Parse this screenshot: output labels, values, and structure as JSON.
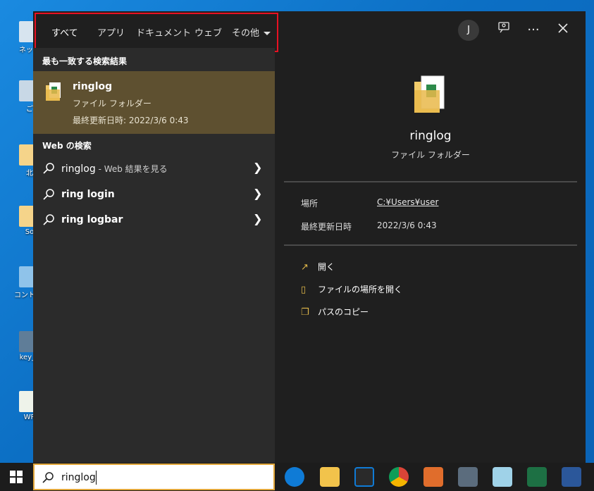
{
  "desktop": {
    "icons": [
      {
        "label": "ネット",
        "icon": "network-icon"
      },
      {
        "label": "ご",
        "icon": "recycle-bin-icon"
      },
      {
        "label": "北",
        "icon": "folder-icon"
      },
      {
        "label": "So",
        "icon": "folder-icon"
      },
      {
        "label": "コントロー",
        "icon": "control-panel-icon"
      },
      {
        "label": "key_p",
        "icon": "keyboard-icon"
      },
      {
        "label": "WR",
        "icon": "document-icon"
      }
    ]
  },
  "tabs": [
    {
      "label": "すべて",
      "active": true
    },
    {
      "label": "アプリ"
    },
    {
      "label": "ドキュメント"
    },
    {
      "label": "ウェブ"
    },
    {
      "label": "その他"
    }
  ],
  "header": {
    "avatar_initial": "J"
  },
  "best_match": {
    "heading": "最も一致する検索結果",
    "name": "ringlog",
    "type": "ファイル フォルダー",
    "modified": "最終更新日時: 2022/3/6 0:43"
  },
  "web": {
    "heading": "Web の検索",
    "results": [
      {
        "query": "ringlog",
        "suffix": " - Web 結果を見る"
      },
      {
        "query": "ring login",
        "suffix": ""
      },
      {
        "query": "ring logbar",
        "suffix": ""
      }
    ]
  },
  "detail": {
    "name": "ringlog",
    "type": "ファイル フォルダー",
    "location_label": "場所",
    "location_value": "C:¥Users¥user",
    "modified_label": "最終更新日時",
    "modified_value": "2022/3/6 0:43",
    "actions": [
      {
        "label": "開く",
        "icon": "open-icon"
      },
      {
        "label": "ファイルの場所を開く",
        "icon": "folder-location-icon"
      },
      {
        "label": "パスのコピー",
        "icon": "copy-icon"
      }
    ]
  },
  "taskbar": {
    "search_value": "ringlog",
    "apps": [
      "edge-icon",
      "file-explorer-icon",
      "store-icon",
      "chrome-icon",
      "media-player-icon",
      "calculator-icon",
      "notepad-icon",
      "excel-icon",
      "word-icon"
    ]
  },
  "colors": {
    "accent": "#e2a73a",
    "highlight_box": "#e81123",
    "best_match_bg": "#5e5030"
  }
}
